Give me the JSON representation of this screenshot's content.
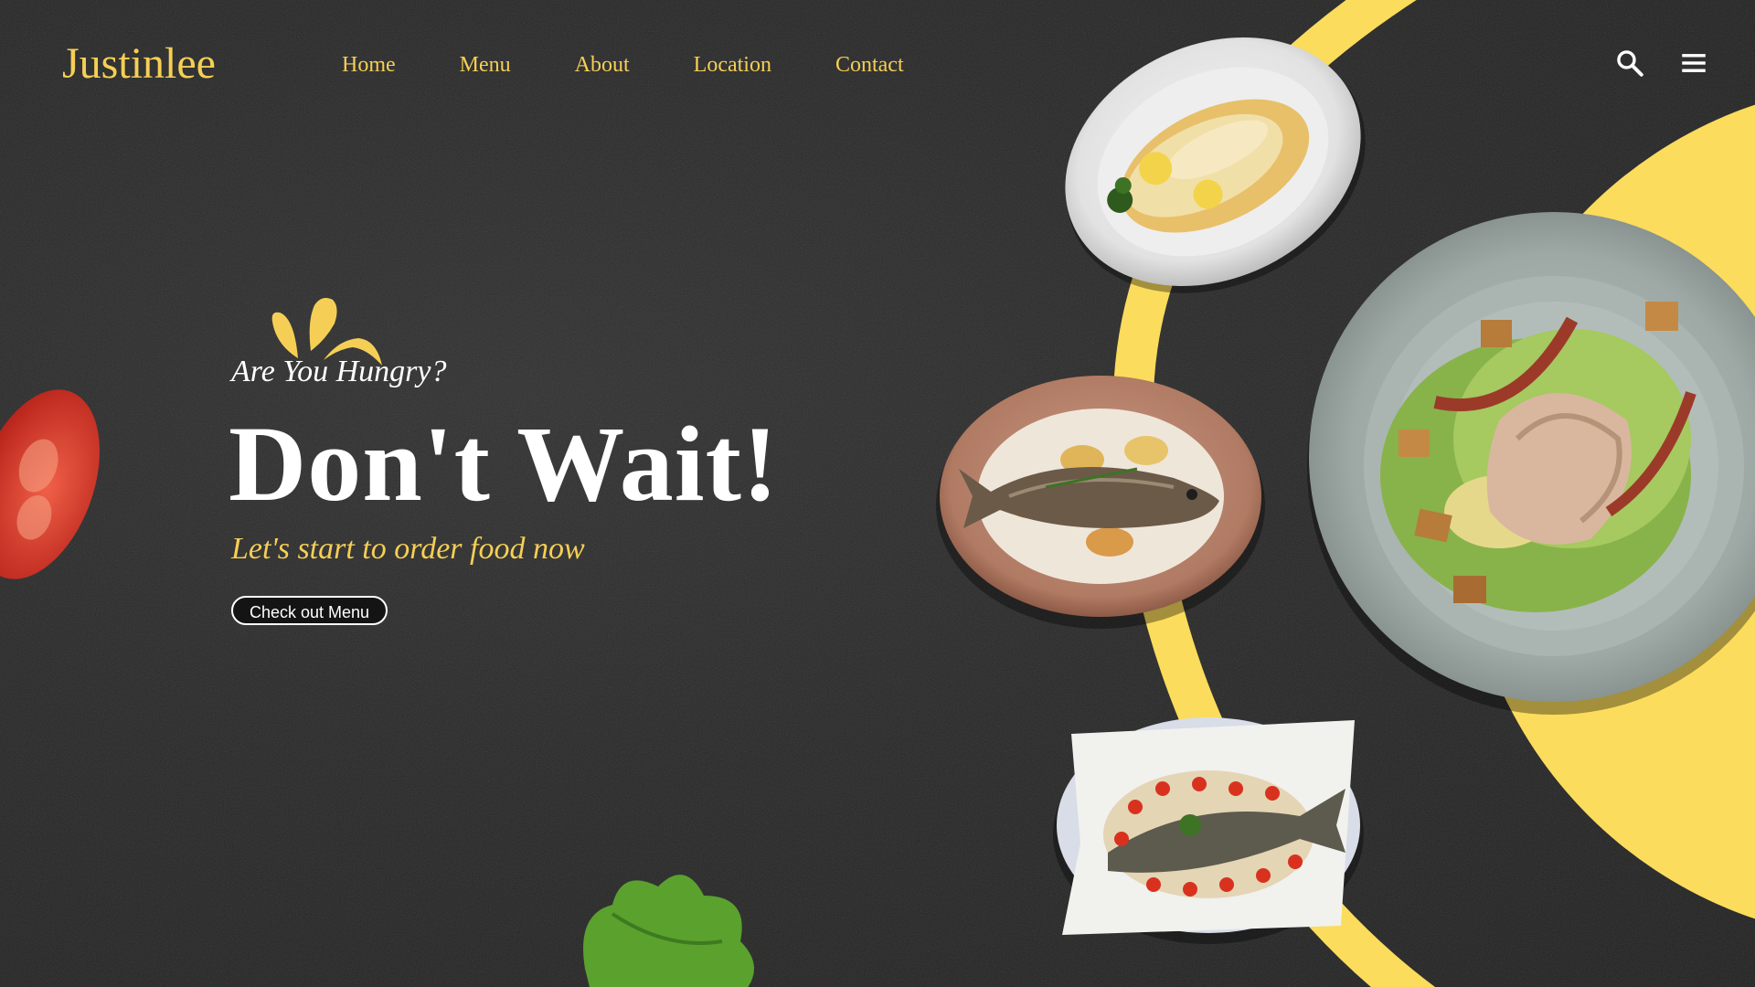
{
  "brand": {
    "name": "Justinlee"
  },
  "nav": {
    "items": [
      {
        "label": "Home"
      },
      {
        "label": "Menu"
      },
      {
        "label": "About"
      },
      {
        "label": "Location"
      },
      {
        "label": "Contact"
      }
    ]
  },
  "header_icons": {
    "search": "search-icon",
    "menu": "hamburger-menu-icon"
  },
  "hero": {
    "eyebrow": "Are You Hungry?",
    "title": "Don't Wait!",
    "subtitle": "Let's start to order food now",
    "cta_label": "Check out Menu"
  },
  "colors": {
    "accent": "#f5cf55",
    "background": "#262626",
    "text": "#ffffff"
  }
}
